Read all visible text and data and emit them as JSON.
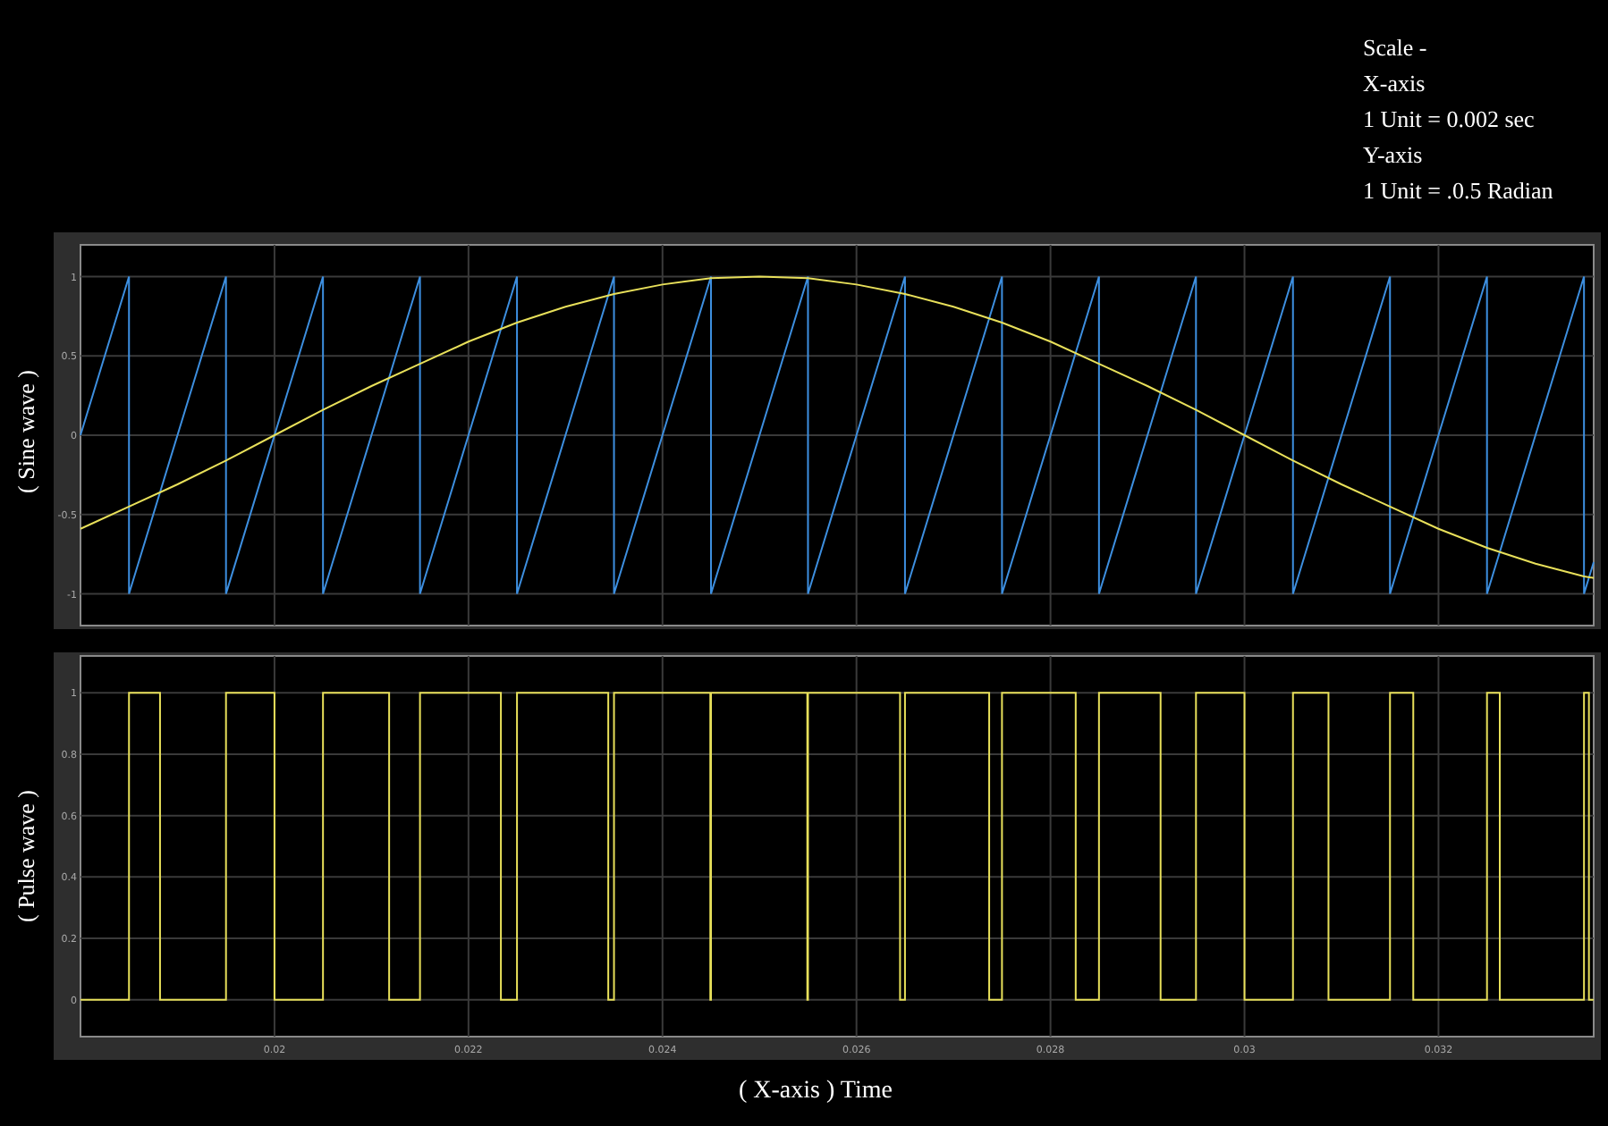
{
  "scale_note": [
    "Scale -",
    "X-axis",
    "1 Unit = 0.002 sec",
    "Y-axis",
    "1 Unit = .0.5 Radian"
  ],
  "charts": [
    {
      "chart_data": {
        "type": "line",
        "grid": true,
        "ylabel": "( Sine wave )",
        "xlim": [
          0.018,
          0.0336
        ],
        "ylim": [
          -1.2,
          1.2
        ],
        "yticks": [
          1,
          0.5,
          0,
          -0.5,
          -1
        ],
        "x": [
          0.018,
          0.0185,
          0.0185,
          0.019,
          0.0195,
          0.0195,
          0.02,
          0.0205,
          0.0205,
          0.021,
          0.0215,
          0.0215,
          0.022,
          0.0225,
          0.0225,
          0.023,
          0.0235,
          0.0235,
          0.024,
          0.0245,
          0.0245,
          0.025,
          0.0255,
          0.0255,
          0.026,
          0.0265,
          0.0265,
          0.027,
          0.0275,
          0.0275,
          0.028,
          0.0285,
          0.0285,
          0.029,
          0.0295,
          0.0295,
          0.03,
          0.0305,
          0.0305,
          0.031,
          0.0315,
          0.0315,
          0.032,
          0.0325,
          0.0325,
          0.033,
          0.0335,
          0.0335,
          0.0336
        ],
        "series": [
          {
            "color": "#3d8fe0",
            "values": [
              0,
              1,
              -1,
              0,
              1,
              -1,
              0,
              1,
              -1,
              0,
              1,
              -1,
              0,
              1,
              -1,
              0,
              1,
              -1,
              0,
              1,
              -1,
              0,
              1,
              -1,
              0,
              1,
              -1,
              0,
              1,
              -1,
              0,
              1,
              -1,
              0,
              1,
              -1,
              0,
              1,
              -1,
              0,
              1,
              -1,
              0,
              1,
              -1,
              0,
              1,
              -1,
              -0.8
            ]
          },
          {
            "color": "#e8e05a",
            "values": [
              -0.59,
              -0.45,
              -0.45,
              -0.31,
              -0.16,
              -0.16,
              0,
              0.16,
              0.16,
              0.31,
              0.45,
              0.45,
              0.59,
              0.71,
              0.71,
              0.81,
              0.89,
              0.89,
              0.95,
              0.99,
              0.99,
              1,
              0.99,
              0.99,
              0.95,
              0.89,
              0.89,
              0.81,
              0.71,
              0.71,
              0.59,
              0.45,
              0.45,
              0.31,
              0.16,
              0.16,
              0,
              -0.16,
              -0.16,
              -0.31,
              -0.45,
              -0.45,
              -0.59,
              -0.71,
              -0.71,
              -0.81,
              -0.89,
              -0.89,
              -0.9
            ]
          }
        ]
      }
    },
    {
      "chart_data": {
        "type": "line",
        "grid": true,
        "ylabel": "( Pulse wave )",
        "xlabel": "( X-axis ) Time",
        "xlim": [
          0.018,
          0.0336
        ],
        "ylim": [
          -0.12,
          1.12
        ],
        "yticks": [
          1,
          0.8,
          0.6,
          0.4,
          0.2,
          0
        ],
        "xticks": [
          0.02,
          0.022,
          0.024,
          0.026,
          0.028,
          0.03,
          0.032
        ],
        "x": [
          0.018,
          0.0185,
          0.0185,
          0.01882,
          0.01882,
          0.0195,
          0.0195,
          0.02,
          0.02,
          0.0205,
          0.0205,
          0.021182,
          0.021182,
          0.0215,
          0.0215,
          0.022334,
          0.022334,
          0.0225,
          0.0225,
          0.023441,
          0.023441,
          0.0235,
          0.0235,
          0.024493,
          0.024493,
          0.0245,
          0.0245,
          0.025493,
          0.025493,
          0.0255,
          0.0255,
          0.026449,
          0.026449,
          0.0265,
          0.0265,
          0.027368,
          0.027368,
          0.0275,
          0.0275,
          0.02826,
          0.02826,
          0.0285,
          0.0285,
          0.029135,
          0.029135,
          0.0295,
          0.0295,
          0.03,
          0.03,
          0.0305,
          0.0305,
          0.030866,
          0.030866,
          0.0315,
          0.0315,
          0.03174,
          0.03174,
          0.0325,
          0.0325,
          0.032632,
          0.032632,
          0.0335,
          0.0335,
          0.033551,
          0.033551,
          0.0336
        ],
        "series": [
          {
            "color": "#e8e05a",
            "values": [
              0,
              0,
              1,
              1,
              0,
              0,
              1,
              1,
              0,
              0,
              1,
              1,
              0,
              0,
              1,
              1,
              0,
              0,
              1,
              1,
              0,
              0,
              1,
              1,
              0,
              0,
              1,
              1,
              0,
              0,
              1,
              1,
              0,
              0,
              1,
              1,
              0,
              0,
              1,
              1,
              0,
              0,
              1,
              1,
              0,
              0,
              1,
              1,
              0,
              0,
              1,
              1,
              0,
              0,
              1,
              1,
              0,
              0,
              1,
              1,
              0,
              0,
              1,
              1,
              0,
              0
            ]
          }
        ]
      }
    }
  ]
}
